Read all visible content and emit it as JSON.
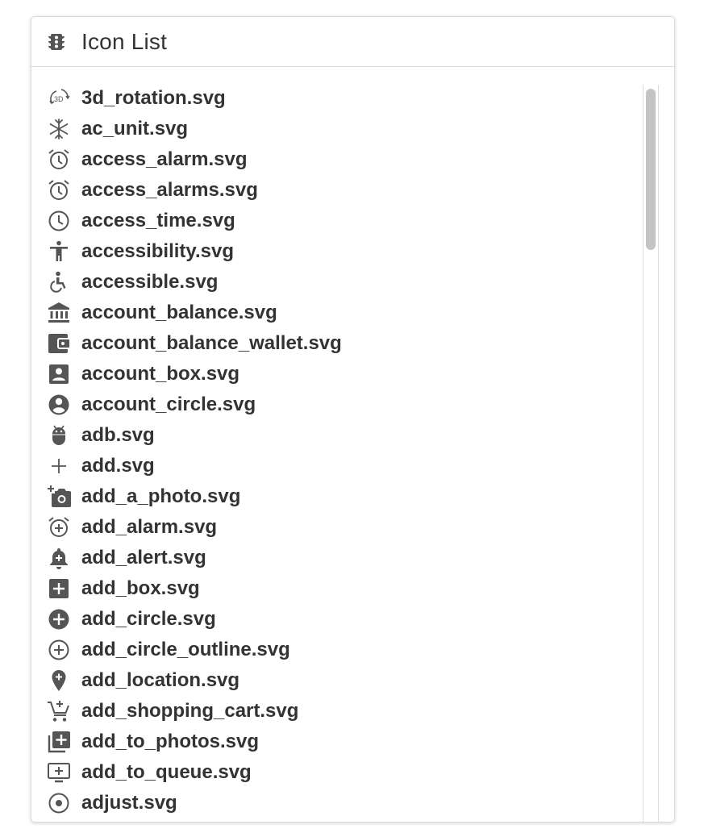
{
  "panel": {
    "title": "Icon List",
    "title_icon": "traffic-light-icon"
  },
  "icon_list": {
    "items": [
      {
        "label": "3d_rotation.svg",
        "icon": "3d-rotation-icon"
      },
      {
        "label": "ac_unit.svg",
        "icon": "snowflake-icon"
      },
      {
        "label": "access_alarm.svg",
        "icon": "alarm-clock-icon"
      },
      {
        "label": "access_alarms.svg",
        "icon": "alarm-clock-icon"
      },
      {
        "label": "access_time.svg",
        "icon": "clock-icon"
      },
      {
        "label": "accessibility.svg",
        "icon": "accessibility-person-icon"
      },
      {
        "label": "accessible.svg",
        "icon": "wheelchair-icon"
      },
      {
        "label": "account_balance.svg",
        "icon": "bank-icon"
      },
      {
        "label": "account_balance_wallet.svg",
        "icon": "wallet-icon"
      },
      {
        "label": "account_box.svg",
        "icon": "account-box-icon"
      },
      {
        "label": "account_circle.svg",
        "icon": "account-circle-icon"
      },
      {
        "label": "adb.svg",
        "icon": "android-icon"
      },
      {
        "label": "add.svg",
        "icon": "plus-icon"
      },
      {
        "label": "add_a_photo.svg",
        "icon": "add-camera-icon"
      },
      {
        "label": "add_alarm.svg",
        "icon": "add-alarm-icon"
      },
      {
        "label": "add_alert.svg",
        "icon": "add-alert-bell-icon"
      },
      {
        "label": "add_box.svg",
        "icon": "add-box-icon"
      },
      {
        "label": "add_circle.svg",
        "icon": "add-circle-icon"
      },
      {
        "label": "add_circle_outline.svg",
        "icon": "add-circle-outline-icon"
      },
      {
        "label": "add_location.svg",
        "icon": "add-location-pin-icon"
      },
      {
        "label": "add_shopping_cart.svg",
        "icon": "add-cart-icon"
      },
      {
        "label": "add_to_photos.svg",
        "icon": "add-to-photos-icon"
      },
      {
        "label": "add_to_queue.svg",
        "icon": "add-to-queue-icon"
      },
      {
        "label": "adjust.svg",
        "icon": "adjust-icon"
      }
    ]
  },
  "colors": {
    "text": "#333333",
    "icon": "#555555",
    "border": "#dddddd",
    "scroll_thumb": "#c4c4c4"
  }
}
